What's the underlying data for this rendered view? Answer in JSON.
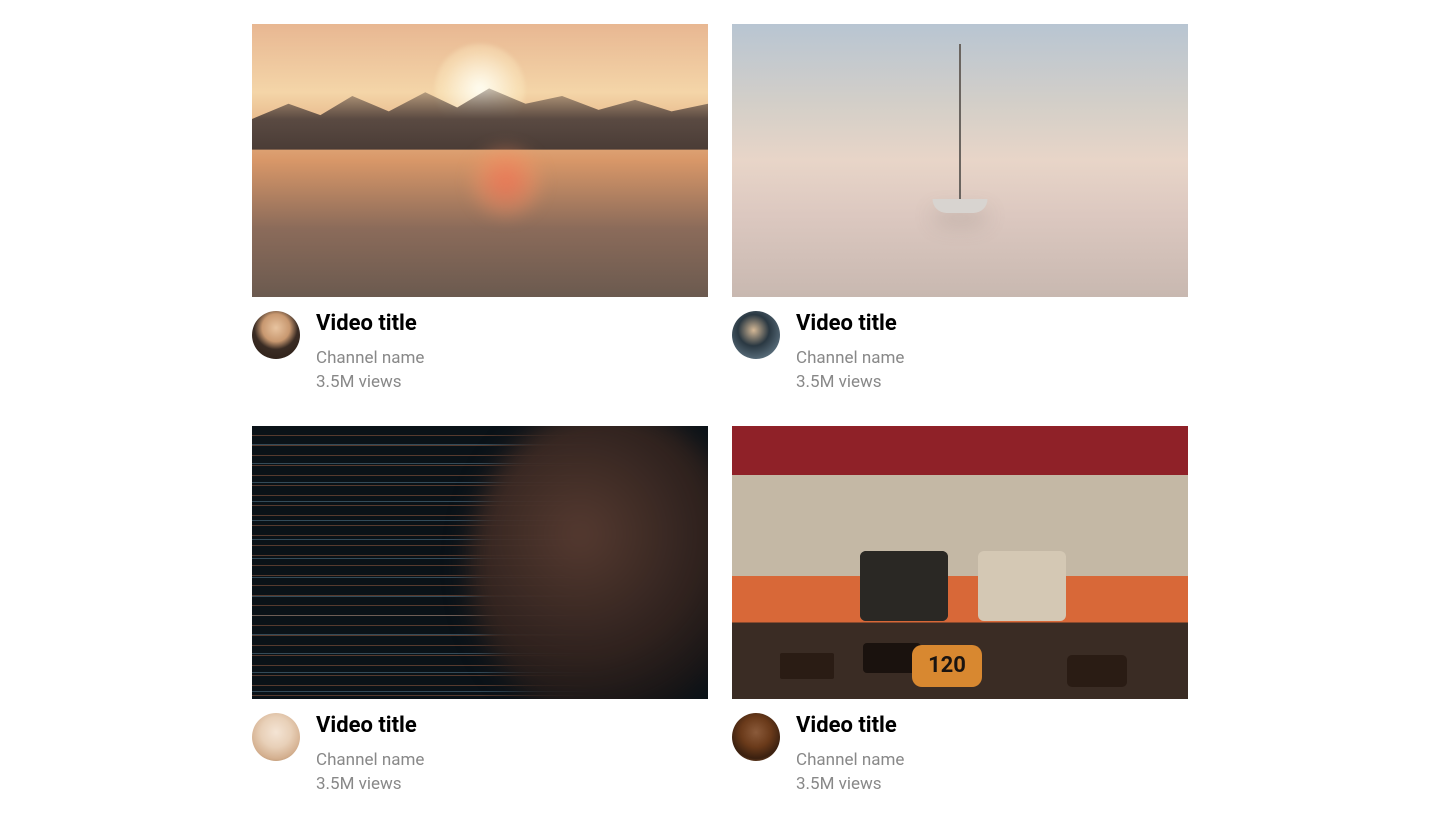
{
  "videos": [
    {
      "title": "Video title",
      "channel": "Channel name",
      "views": "3.5M views"
    },
    {
      "title": "Video title",
      "channel": "Channel name",
      "views": "3.5M views"
    },
    {
      "title": "Video title",
      "channel": "Channel name",
      "views": "3.5M views"
    },
    {
      "title": "Video title",
      "channel": "Channel name",
      "views": "3.5M views"
    }
  ]
}
